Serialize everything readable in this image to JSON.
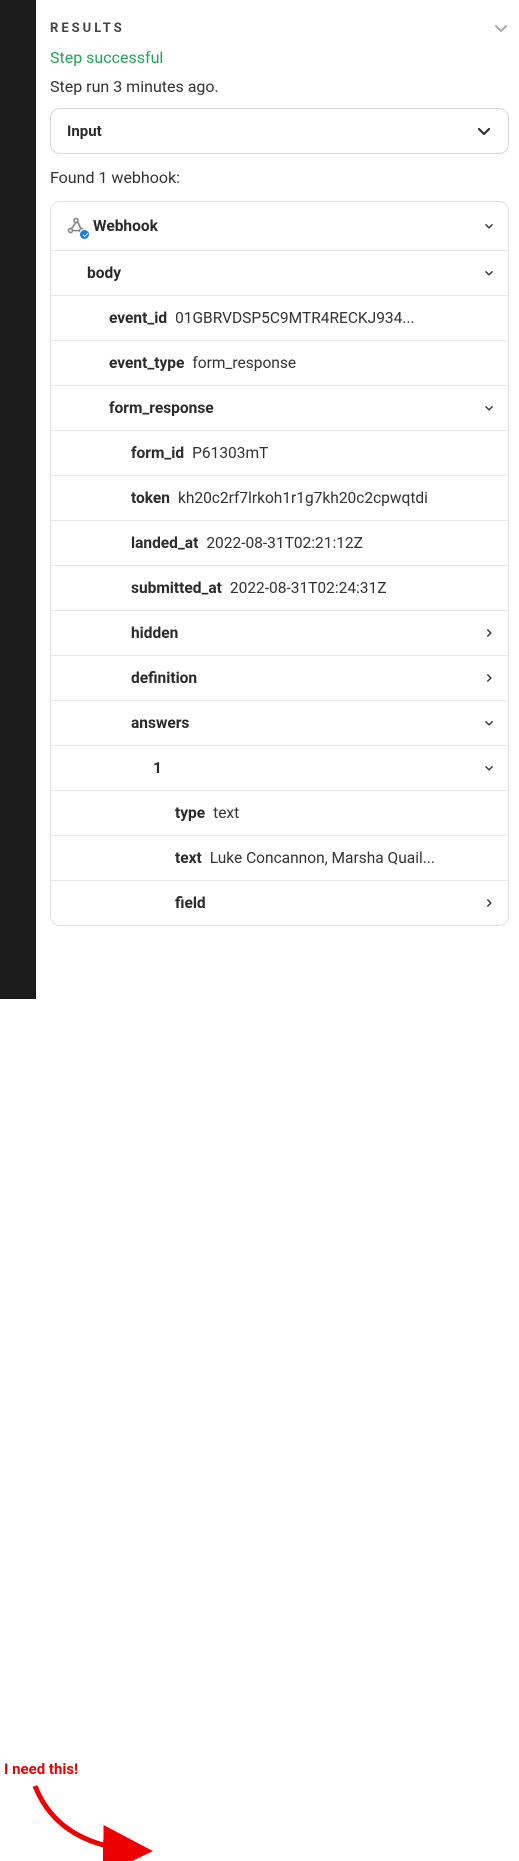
{
  "header": {
    "title": "RESULTS"
  },
  "status": {
    "text": "Step successful",
    "meta": "Step run 3 minutes ago."
  },
  "input_box": {
    "label": "Input"
  },
  "found": "Found 1 webhook:",
  "tree": {
    "webhook_label": "Webhook",
    "body_label": "body",
    "event_id_key": "event_id",
    "event_id_val": "01GBRVDSP5C9MTR4RECKJ934...",
    "event_type_key": "event_type",
    "event_type_val": "form_response",
    "form_response_key": "form_response",
    "form_id_key": "form_id",
    "form_id_val": "P61303mT",
    "token_key": "token",
    "token_val": "kh20c2rf7lrkoh1r1g7kh20c2cpwqtdi",
    "landed_at_key": "landed_at",
    "landed_at_val": "2022-08-31T02:21:12Z",
    "submitted_at_key": "submitted_at",
    "submitted_at_val": "2022-08-31T02:24:31Z",
    "hidden_key": "hidden",
    "definition_key": "definition",
    "answers_key": "answers",
    "answer1_key": "1",
    "type_key": "type",
    "type_val": "text",
    "text_key": "text",
    "text_val": "Luke Concannon, Marsha Quail...",
    "field_key": "field"
  },
  "annotation": {
    "text": "I need this!"
  },
  "colors": {
    "success": "#22a559",
    "annotation": "#ee0000",
    "sidebar": "#1b1b1b",
    "badge": "#1877f2"
  }
}
